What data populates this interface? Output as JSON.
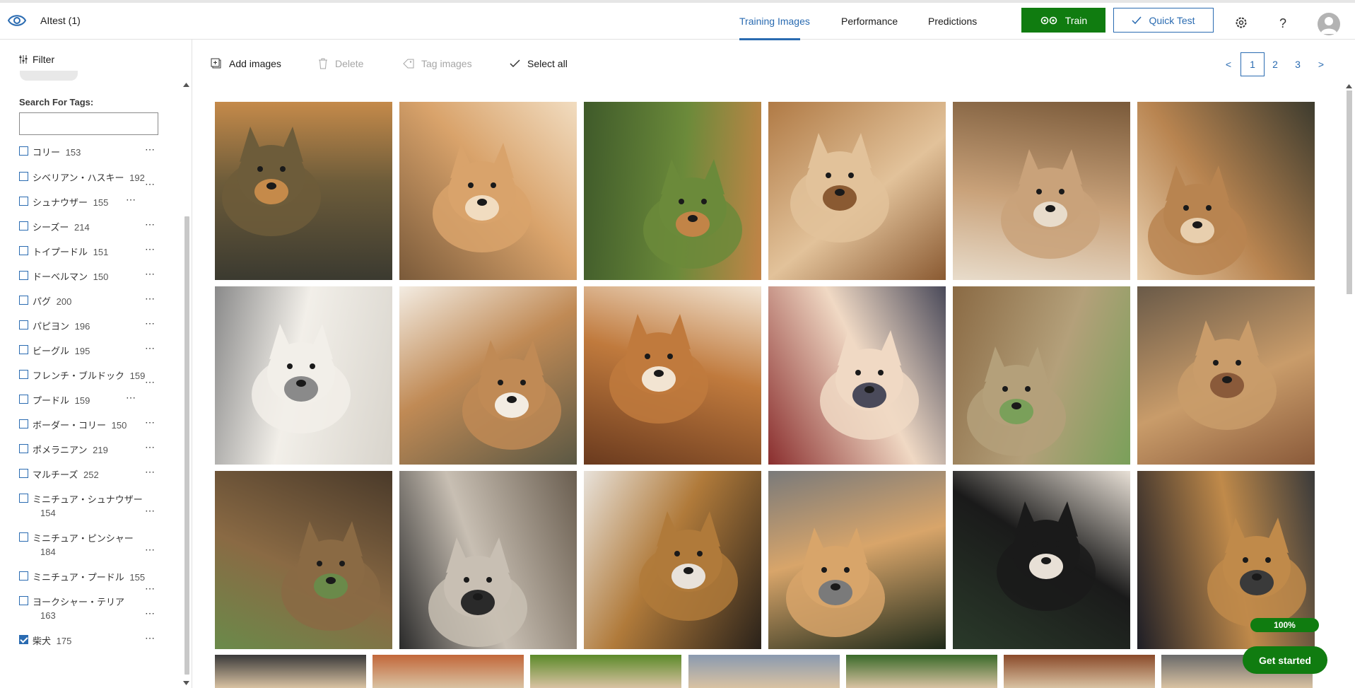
{
  "app": {
    "title": "AItest (1)"
  },
  "nav": {
    "tabs": [
      {
        "label": "Training Images",
        "active": true
      },
      {
        "label": "Performance",
        "active": false
      },
      {
        "label": "Predictions",
        "active": false
      }
    ],
    "train_label": "Train",
    "quick_test_label": "Quick Test"
  },
  "sidebar": {
    "filter_label": "Filter",
    "search_label": "Search For Tags:",
    "search_value": "",
    "tags": [
      {
        "name": "コリー",
        "count": "153",
        "checked": false
      },
      {
        "name": "シベリアン・ハスキー",
        "count": "192",
        "checked": false
      },
      {
        "name": "シュナウザー",
        "count": "155",
        "checked": false
      },
      {
        "name": "シーズー",
        "count": "214",
        "checked": false
      },
      {
        "name": "トイプードル",
        "count": "151",
        "checked": false
      },
      {
        "name": "ドーベルマン",
        "count": "150",
        "checked": false
      },
      {
        "name": "パグ",
        "count": "200",
        "checked": false
      },
      {
        "name": "パピヨン",
        "count": "196",
        "checked": false
      },
      {
        "name": "ビーグル",
        "count": "195",
        "checked": false
      },
      {
        "name": "フレンチ・ブルドック",
        "count": "159",
        "checked": false
      },
      {
        "name": "プードル",
        "count": "159",
        "checked": false
      },
      {
        "name": "ボーダー・コリー",
        "count": "150",
        "checked": false
      },
      {
        "name": "ポメラニアン",
        "count": "219",
        "checked": false
      },
      {
        "name": "マルチーズ",
        "count": "252",
        "checked": false
      },
      {
        "name": "ミニチュア・シュナウザー",
        "count": "154",
        "checked": false
      },
      {
        "name": "ミニチュア・ピンシャー",
        "count": "184",
        "checked": false
      },
      {
        "name": "ミニチュア・プードル",
        "count": "155",
        "checked": false
      },
      {
        "name": "ヨークシャー・テリア",
        "count": "163",
        "checked": false
      },
      {
        "name": "柴犬",
        "count": "175",
        "checked": true
      }
    ]
  },
  "toolbar": {
    "add_label": "Add images",
    "delete_label": "Delete",
    "tag_label": "Tag images",
    "select_all_label": "Select all"
  },
  "pagination": {
    "prev": "<",
    "pages": [
      "1",
      "2",
      "3"
    ],
    "current": "1",
    "next": ">"
  },
  "status": {
    "progress_label": "100%",
    "get_started_label": "Get started"
  },
  "colors": {
    "accent": "#2a6bb1",
    "primary_green": "#107c10"
  }
}
